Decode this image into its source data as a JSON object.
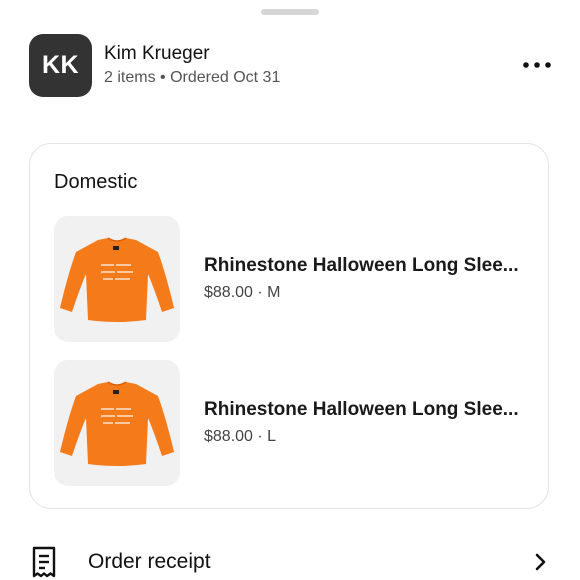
{
  "header": {
    "avatar_initials": "KK",
    "customer_name": "Kim Krueger",
    "order_meta": "2 items • Ordered Oct 31",
    "more_icon": "more-horizontal-icon"
  },
  "section": {
    "title": "Domestic",
    "items": [
      {
        "title": "Rhinestone Halloween Long Slee...",
        "price": "$88.00",
        "separator": " · ",
        "size": "M",
        "image": "orange-long-sleeve-shirt"
      },
      {
        "title": "Rhinestone Halloween Long Slee...",
        "price": "$88.00",
        "separator": " · ",
        "size": "L",
        "image": "orange-long-sleeve-shirt"
      }
    ]
  },
  "receipt": {
    "label": "Order receipt",
    "icon": "receipt-icon",
    "chevron": "chevron-right-icon"
  },
  "colors": {
    "avatar_bg": "#333333",
    "shirt": "#f47a1a",
    "thumb_bg": "#f1f1f1"
  }
}
